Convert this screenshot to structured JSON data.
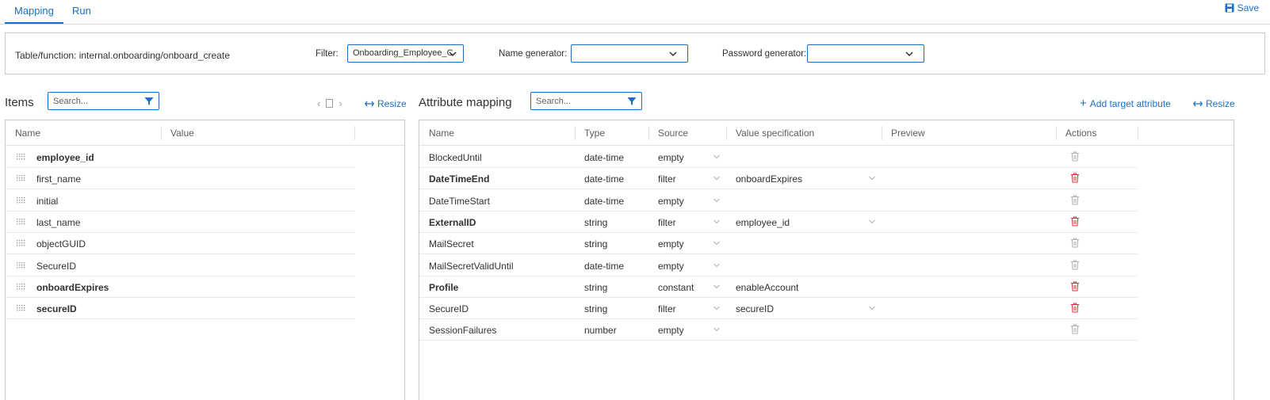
{
  "tabs": [
    {
      "label": "Mapping",
      "active": true
    },
    {
      "label": "Run",
      "active": false
    }
  ],
  "save_label": "Save",
  "config": {
    "table_function": "Table/function: internal.onboarding/onboard_create",
    "filter_label": "Filter:",
    "filter_value": "Onboarding_Employee_C",
    "name_generator_label": "Name generator:",
    "name_generator_value": "",
    "password_generator_label": "Password generator:",
    "password_generator_value": ""
  },
  "items": {
    "title": "Items",
    "search_placeholder": "Search...",
    "resize_label": "Resize",
    "columns": [
      "Name",
      "Value"
    ],
    "rows": [
      {
        "name": "employee_id",
        "bold": true
      },
      {
        "name": "first_name",
        "bold": false
      },
      {
        "name": "initial",
        "bold": false
      },
      {
        "name": "last_name",
        "bold": false
      },
      {
        "name": "objectGUID",
        "bold": false
      },
      {
        "name": "SecureID",
        "bold": false
      },
      {
        "name": "onboardExpires",
        "bold": true
      },
      {
        "name": "secureID",
        "bold": true
      }
    ]
  },
  "mapping": {
    "title": "Attribute mapping",
    "search_placeholder": "Search...",
    "add_label": "Add target attribute",
    "resize_label": "Resize",
    "columns": [
      "Name",
      "Type",
      "Source",
      "Value specification",
      "Preview",
      "Actions"
    ],
    "rows": [
      {
        "name": "BlockedUntil",
        "type": "date-time",
        "source": "empty",
        "value": "",
        "bold": false
      },
      {
        "name": "DateTimeEnd",
        "type": "date-time",
        "source": "filter",
        "value": "onboardExpires",
        "bold": true
      },
      {
        "name": "DateTimeStart",
        "type": "date-time",
        "source": "empty",
        "value": "",
        "bold": false
      },
      {
        "name": "ExternalID",
        "type": "string",
        "source": "filter",
        "value": "employee_id",
        "bold": true
      },
      {
        "name": "MailSecret",
        "type": "string",
        "source": "empty",
        "value": "",
        "bold": false
      },
      {
        "name": "MailSecretValidUntil",
        "type": "date-time",
        "source": "empty",
        "value": "",
        "bold": false
      },
      {
        "name": "Profile",
        "type": "string",
        "source": "constant",
        "value": "enableAccount",
        "bold": true
      },
      {
        "name": "SecureID",
        "type": "string",
        "source": "filter",
        "value": "secureID",
        "bold": false
      },
      {
        "name": "SessionFailures",
        "type": "number",
        "source": "empty",
        "value": "",
        "bold": false
      }
    ]
  },
  "colors": {
    "accent": "#1a6fc4",
    "delete_active": "#d13438",
    "delete_inactive": "#b3b0ad"
  }
}
